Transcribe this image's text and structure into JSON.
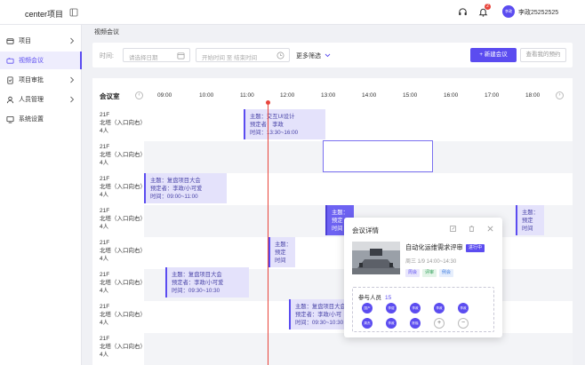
{
  "app": {
    "title": "center项目"
  },
  "user": {
    "avatar_text": "李政",
    "name": "李政25252525",
    "notifications": "2"
  },
  "sidebar": {
    "items": [
      {
        "label": "项目",
        "icon": "project-icon",
        "expandable": true,
        "active": false
      },
      {
        "label": "视频会议",
        "icon": "video-icon",
        "expandable": false,
        "active": true
      },
      {
        "label": "项目审批",
        "icon": "approval-icon",
        "expandable": true,
        "active": false
      },
      {
        "label": "人员管理",
        "icon": "user-icon",
        "expandable": true,
        "active": false
      },
      {
        "label": "系统设置",
        "icon": "settings-icon",
        "expandable": false,
        "active": false
      }
    ]
  },
  "breadcrumb": "视频会议",
  "filters": {
    "time_label": "时间:",
    "date_placeholder": "请选择日期",
    "range_placeholder": "开始时间 至 结束时间",
    "more_label": "更多筛选",
    "new_meeting": "+ 新建会议",
    "my_bookings": "查看我的预约"
  },
  "schedule": {
    "room_header": "会议室",
    "times": [
      "09:00",
      "10:00",
      "11:00",
      "12:00",
      "13:00",
      "14:00",
      "15:00",
      "16:00",
      "17:00",
      "18:00"
    ],
    "rooms": [
      {
        "line1": "21F",
        "line2": "北塔（入口向右）",
        "line3": "4人"
      },
      {
        "line1": "21F",
        "line2": "北塔（入口向右）",
        "line3": "4人"
      },
      {
        "line1": "21F",
        "line2": "北塔（入口向右）",
        "line3": "4人"
      },
      {
        "line1": "21F",
        "line2": "北塔（入口向右）",
        "line3": "4人"
      },
      {
        "line1": "21F",
        "line2": "北塔（入口向右）",
        "line3": "4人"
      },
      {
        "line1": "21F",
        "line2": "北塔（入口向右）",
        "line3": "4人"
      },
      {
        "line1": "21F",
        "line2": "北塔（入口向右）",
        "line3": "4人"
      },
      {
        "line1": "21F",
        "line2": "北塔（入口向右）",
        "line3": "4人"
      }
    ],
    "bookings": [
      {
        "l1": "主题：交互UI设计",
        "l2": "预定者：李政",
        "l3": "时间：13:30~16:00"
      },
      {
        "l1": "主题：复盘项目大会",
        "l2": "预定者：李政/小可爱",
        "l3": "时间：09:00~11:00"
      },
      {
        "l1": "主题：",
        "l2": "预定",
        "l3": "时间"
      },
      {
        "l1": "主题：",
        "l2": "预定",
        "l3": "时间"
      },
      {
        "l1": "主题：",
        "l2": "预定",
        "l3": "时间"
      },
      {
        "l1": "主题：复盘项目大会",
        "l2": "预定者：李政/小可爱",
        "l3": "时间：09:30~10:30"
      },
      {
        "l1": "主题：复盘项目大会",
        "l2": "预定者：李政/小可",
        "l3": "时间：09:30~10:30"
      }
    ]
  },
  "popup": {
    "title": "会议详情",
    "meeting_name": "自动化运维需求评审",
    "status": "进行中",
    "time": "周三 1/9   14:00~14:30",
    "tags": [
      "周会",
      "评审",
      "例会"
    ],
    "participants_label": "参与人员",
    "participants_count": "15",
    "participants": [
      "国产",
      "李煜",
      "李政",
      "李政",
      "李政",
      "周杰",
      "李政",
      "陈楷"
    ],
    "add_symbol": "+",
    "remove_symbol": "−"
  }
}
